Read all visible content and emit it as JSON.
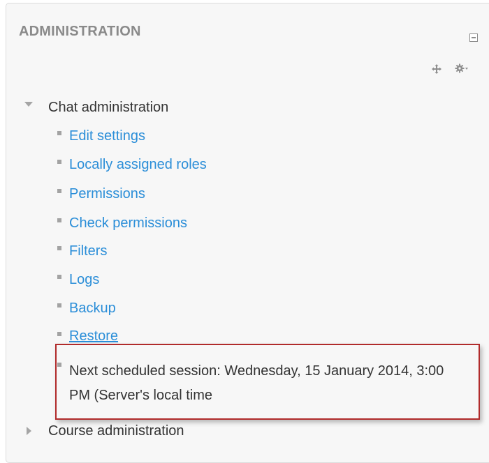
{
  "block": {
    "title": "ADMINISTRATION",
    "icons": {
      "hide": "minimize-icon",
      "move": "move-icon",
      "actions": "gear-icon"
    }
  },
  "chat_admin": {
    "label": "Chat administration",
    "expanded": true,
    "items": [
      {
        "label": "Edit settings"
      },
      {
        "label": "Locally assigned roles"
      },
      {
        "label": "Permissions"
      },
      {
        "label": "Check permissions"
      },
      {
        "label": "Filters"
      },
      {
        "label": "Logs"
      },
      {
        "label": "Backup"
      },
      {
        "label": "Restore"
      }
    ],
    "next_session": "Next scheduled session: Wednesday, 15 January 2014, 3:00 PM (Server's local time"
  },
  "course_admin": {
    "label": "Course administration",
    "expanded": false
  },
  "colors": {
    "link": "#2b8ed8",
    "text": "#333333",
    "highlight_border": "#b12b2b",
    "bullet": "#a3a3a3"
  }
}
